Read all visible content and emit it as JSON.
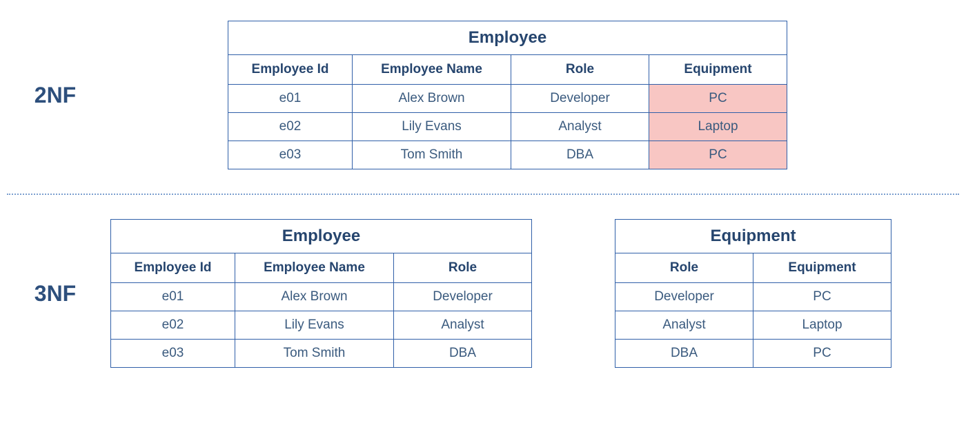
{
  "labels": {
    "nf2": "2NF",
    "nf3": "3NF"
  },
  "top": {
    "employee": {
      "title": "Employee",
      "headers": {
        "id": "Employee Id",
        "name": "Employee Name",
        "role": "Role",
        "equipment": "Equipment"
      },
      "rows": [
        {
          "id": "e01",
          "name": "Alex Brown",
          "role": "Developer",
          "equipment": "PC"
        },
        {
          "id": "e02",
          "name": "Lily Evans",
          "role": "Analyst",
          "equipment": "Laptop"
        },
        {
          "id": "e03",
          "name": "Tom Smith",
          "role": "DBA",
          "equipment": "PC"
        }
      ]
    }
  },
  "bottom": {
    "employee": {
      "title": "Employee",
      "headers": {
        "id": "Employee Id",
        "name": "Employee Name",
        "role": "Role"
      },
      "rows": [
        {
          "id": "e01",
          "name": "Alex Brown",
          "role": "Developer"
        },
        {
          "id": "e02",
          "name": "Lily Evans",
          "role": "Analyst"
        },
        {
          "id": "e03",
          "name": "Tom Smith",
          "role": "DBA"
        }
      ]
    },
    "equipment": {
      "title": "Equipment",
      "headers": {
        "role": "Role",
        "equipment": "Equipment"
      },
      "rows": [
        {
          "role": "Developer",
          "equipment": "PC"
        },
        {
          "role": "Analyst",
          "equipment": "Laptop"
        },
        {
          "role": "DBA",
          "equipment": "PC"
        }
      ]
    }
  }
}
